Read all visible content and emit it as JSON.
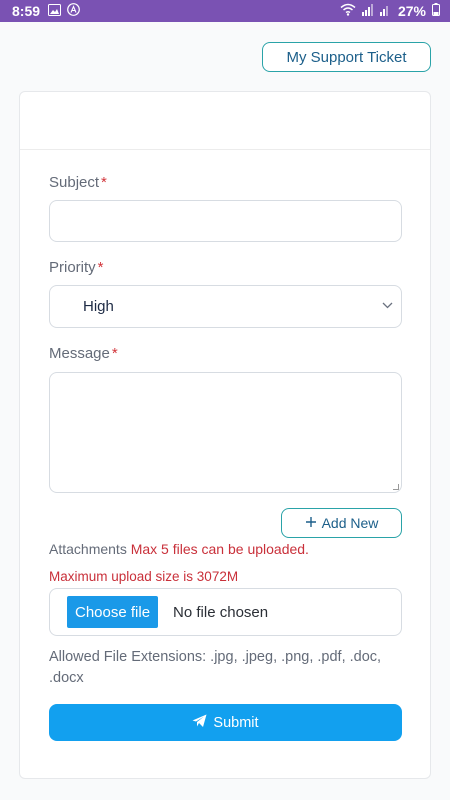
{
  "status_bar": {
    "time": "8:59",
    "battery": "27%",
    "icons": [
      "image-icon",
      "a-circle-icon",
      "wifi-icon",
      "signal-icon",
      "signal-r-icon",
      "battery-icon"
    ]
  },
  "header": {
    "my_support_ticket_label": "My Support Ticket"
  },
  "form": {
    "subject": {
      "label": "Subject",
      "required_mark": "*",
      "value": ""
    },
    "priority": {
      "label": "Priority",
      "required_mark": "*",
      "selected": "High"
    },
    "message": {
      "label": "Message",
      "required_mark": "*",
      "value": ""
    },
    "add_new_label": "Add New",
    "attachments": {
      "label": "Attachments",
      "limit_text": "Max 5 files can be uploaded.",
      "max_size_text": "Maximum upload size is 3072M",
      "choose_file_label": "Choose file",
      "no_file_text": "No file chosen",
      "allowed_text": "Allowed File Extensions: .jpg, .jpeg, .png, .pdf, .doc, .docx"
    },
    "submit_label": "Submit"
  },
  "colors": {
    "status_bar": "#7a52b3",
    "accent_teal": "#2aa3a8",
    "primary_blue": "#12a0ef",
    "required_red": "#d2343a"
  }
}
